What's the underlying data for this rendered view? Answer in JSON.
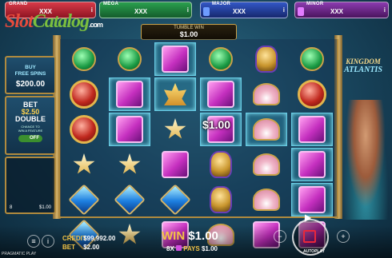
{
  "jackpots": [
    {
      "label": "GRAND",
      "value": "XXX",
      "color": "#c22b3a",
      "gem": "#e3424f"
    },
    {
      "label": "MEGA",
      "value": "XXX",
      "color": "#1f7b3c",
      "gem": "#3fd86a"
    },
    {
      "label": "MAJOR",
      "value": "XXX",
      "color": "#233f9c",
      "gem": "#5a8cff"
    },
    {
      "label": "MINOR",
      "value": "XXX",
      "color": "#6d2a8a",
      "gem": "#d05ef3"
    }
  ],
  "watermark": {
    "part1": "Slot",
    "part2": "Catalog",
    "suffix": ".com"
  },
  "tumble": {
    "label": "TUMBLE WIN",
    "value": "$1.00"
  },
  "buy_panel": {
    "line1": "BUY",
    "line2": "FREE SPINS",
    "price": "$200.00"
  },
  "bet_panel": {
    "line1": "BET",
    "line2": "$2.50",
    "line3": "DOUBLE",
    "line4": "CHANCE TO",
    "line5": "WIN A FEATURE",
    "toggle": "OFF"
  },
  "image_panel": {
    "count": "8",
    "amount": "$1.00"
  },
  "game_logo": {
    "line1": "KINGDOM",
    "line2": "ATLANTIS"
  },
  "grid": [
    [
      "green",
      "red",
      "red",
      "star",
      "blue",
      "blue"
    ],
    [
      "green",
      "pink",
      "pink",
      "star",
      "blue",
      "star"
    ],
    [
      "pink",
      "crown",
      "star",
      "pink",
      "blue",
      "pink"
    ],
    [
      "green",
      "pink",
      "pink",
      "urn",
      "urn",
      "shell"
    ],
    [
      "urn",
      "shell",
      "shell",
      "shell",
      "shell",
      "pink"
    ],
    [
      "green",
      "red",
      "pink",
      "pink",
      "pink",
      "pink"
    ]
  ],
  "highlighted": [
    [
      1,
      2
    ],
    [
      2,
      0
    ],
    [
      3,
      2
    ],
    [
      5,
      2
    ],
    [
      5,
      3
    ],
    [
      5,
      4
    ],
    [
      1,
      1
    ],
    [
      2,
      1
    ],
    [
      3,
      1
    ],
    [
      4,
      2
    ]
  ],
  "win_amount": "$1.00",
  "footer": {
    "credit_label": "CREDIT",
    "credit_value": "$99,992.00",
    "bet_label": "BET",
    "bet_value": "$2.00",
    "win_label": "WIN",
    "win_value": "$1.00",
    "multiplier": "8X",
    "pays_label": "PAYS",
    "pays_value": "$1.00",
    "autoplay": "AUTOPLAY",
    "provider": "PRAGMATIC PLAY"
  }
}
